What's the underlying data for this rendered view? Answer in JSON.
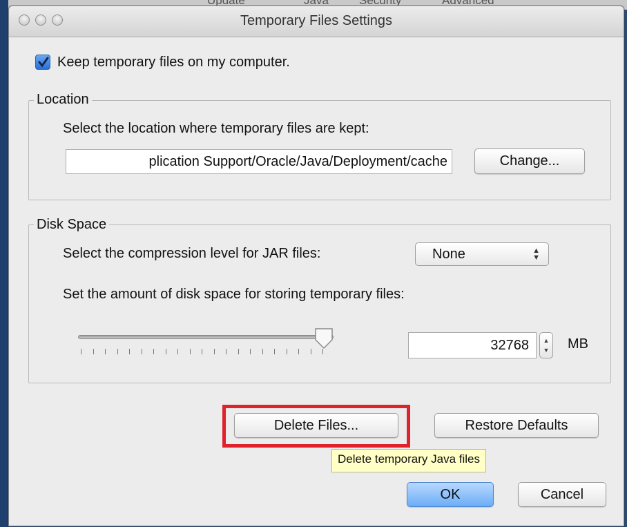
{
  "background_window": {
    "tab_fragments": [
      "Update",
      "Java",
      "Security",
      "Advanced"
    ]
  },
  "window": {
    "title": "Temporary Files Settings"
  },
  "keep_files": {
    "checked": true,
    "label": "Keep temporary files on my computer."
  },
  "location": {
    "legend": "Location",
    "instruction": "Select the location where temporary files are kept:",
    "path_value": "plication Support/Oracle/Java/Deployment/cache",
    "change_label": "Change..."
  },
  "disk_space": {
    "legend": "Disk Space",
    "compression_label": "Select the compression level for JAR files:",
    "compression_value": "None",
    "amount_label": "Set the amount of disk space for storing temporary files:",
    "slider_level": 1.0,
    "size_value": "32768",
    "unit": "MB"
  },
  "actions": {
    "delete_label": "Delete Files...",
    "restore_label": "Restore Defaults",
    "tooltip": "Delete temporary Java files",
    "ok_label": "OK",
    "cancel_label": "Cancel"
  },
  "colors": {
    "highlight": "#e0222b",
    "default_button": "#6aaef6",
    "tooltip_bg": "#ffffc6"
  },
  "icons": [
    "checkmark-icon",
    "stepper-arrows-icon",
    "slider-thumb-icon"
  ]
}
